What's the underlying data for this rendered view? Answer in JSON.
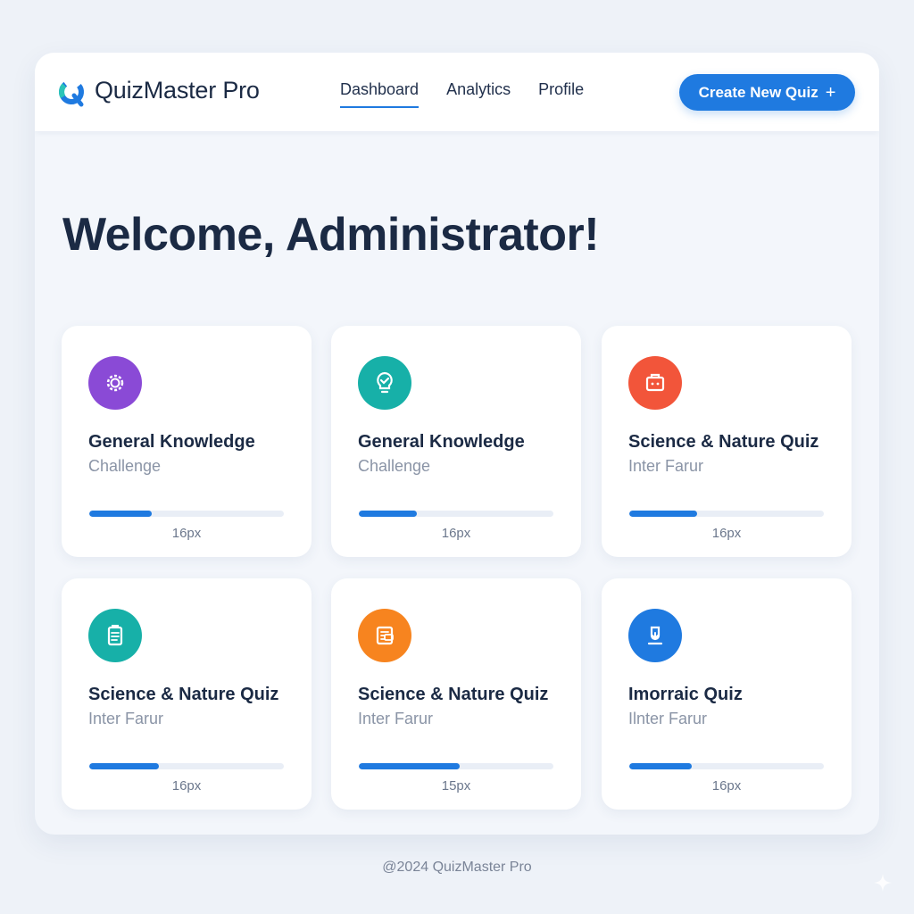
{
  "header": {
    "brand": "QuizMaster Pro",
    "nav": [
      {
        "label": "Dashboard",
        "active": true
      },
      {
        "label": "Analytics",
        "active": false
      },
      {
        "label": "Profile",
        "active": false
      }
    ],
    "create_button": {
      "label": "Create New Quiz",
      "icon": "plus-icon"
    }
  },
  "main": {
    "welcome": "Welcome, Administrator!"
  },
  "cards": [
    {
      "title": "General Knowledge",
      "subtitle": "Challenge",
      "progress": 0.32,
      "meta": "16px",
      "icon": "gear-icon",
      "color": "#8a4ad6"
    },
    {
      "title": "General Knowledge",
      "subtitle": "Challenge",
      "progress": 0.3,
      "meta": "16px",
      "icon": "lightbulb-check-icon",
      "color": "#17b0a8"
    },
    {
      "title": "Science & Nature Quiz",
      "subtitle": "Inter Farur",
      "progress": 0.35,
      "meta": "16px",
      "icon": "briefcase-icon",
      "color": "#f2553a"
    },
    {
      "title": "Science & Nature Quiz",
      "subtitle": "Inter Farur",
      "progress": 0.36,
      "meta": "16px",
      "icon": "clipboard-icon",
      "color": "#17b0a8"
    },
    {
      "title": "Science & Nature Quiz",
      "subtitle": "Inter Farur",
      "progress": 0.52,
      "meta": "15px",
      "icon": "document-icon",
      "color": "#f7841f"
    },
    {
      "title": "Imorraic Quiz",
      "subtitle": "Ilnter Farur",
      "progress": 0.32,
      "meta": "16px",
      "icon": "download-icon",
      "color": "#1f7ae0"
    }
  ],
  "footer": {
    "text": "@2024 QuizMaster Pro"
  },
  "colors": {
    "accent": "#1f7ae0",
    "background": "#eef2f8",
    "text": "#1b2a44"
  }
}
